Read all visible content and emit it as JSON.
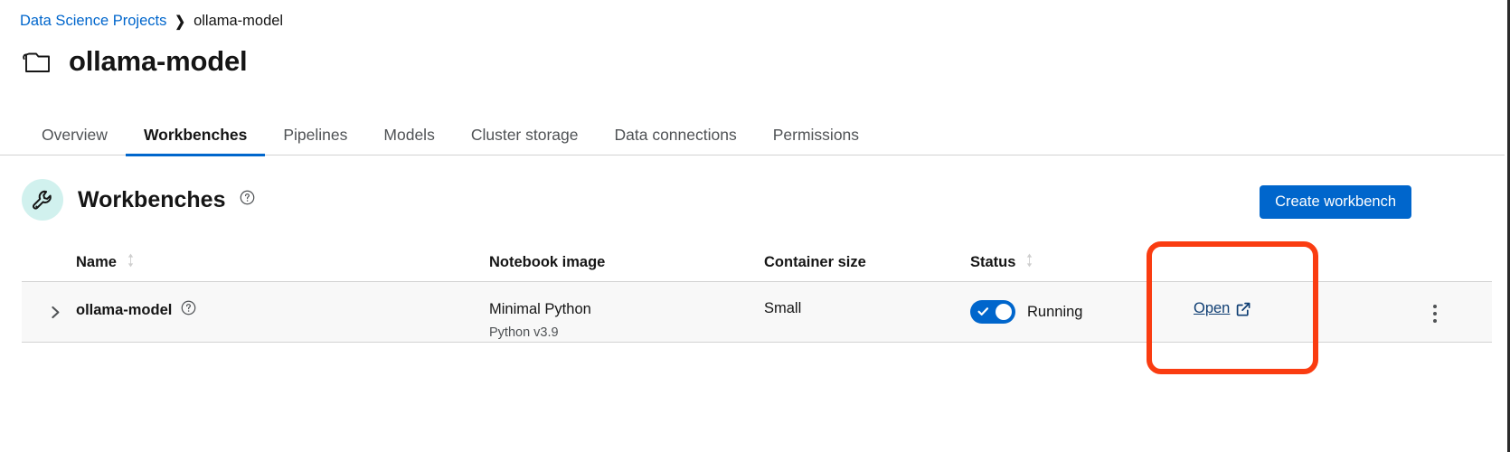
{
  "breadcrumb": {
    "parent": "Data Science Projects",
    "separator": "❯",
    "current": "ollama-model"
  },
  "header": {
    "title": "ollama-model",
    "icon": "project-folder-icon"
  },
  "tabs": [
    {
      "label": "Overview",
      "active": false
    },
    {
      "label": "Workbenches",
      "active": true
    },
    {
      "label": "Pipelines",
      "active": false
    },
    {
      "label": "Models",
      "active": false
    },
    {
      "label": "Cluster storage",
      "active": false
    },
    {
      "label": "Data connections",
      "active": false
    },
    {
      "label": "Permissions",
      "active": false
    }
  ],
  "section": {
    "title": "Workbenches",
    "icon": "wrench-icon",
    "help_icon": "help-circle-icon",
    "icon_bg": "#d1f1ee"
  },
  "actions": {
    "create_workbench": "Create workbench",
    "create_workbench_color": "#0066cc"
  },
  "table": {
    "columns": [
      {
        "label": "Name",
        "sortable": true
      },
      {
        "label": "Notebook image",
        "sortable": false
      },
      {
        "label": "Container size",
        "sortable": false
      },
      {
        "label": "Status",
        "sortable": true
      },
      {
        "label": "",
        "sortable": false
      },
      {
        "label": "",
        "sortable": false
      }
    ],
    "rows": [
      {
        "name": "ollama-model",
        "name_help_icon": "help-circle-icon",
        "expand_icon": "chevron-right-icon",
        "notebook_image": "Minimal Python",
        "notebook_image_version": "Python v3.9",
        "container_size": "Small",
        "status": "Running",
        "status_toggle_on": true,
        "status_toggle_color": "#0066cc",
        "open_label": "Open",
        "open_icon": "external-link-icon",
        "kebab_icon": "kebab-menu-icon"
      }
    ]
  },
  "annotation": {
    "highlight_color": "#fa3c11",
    "target": "open-link-cell"
  }
}
